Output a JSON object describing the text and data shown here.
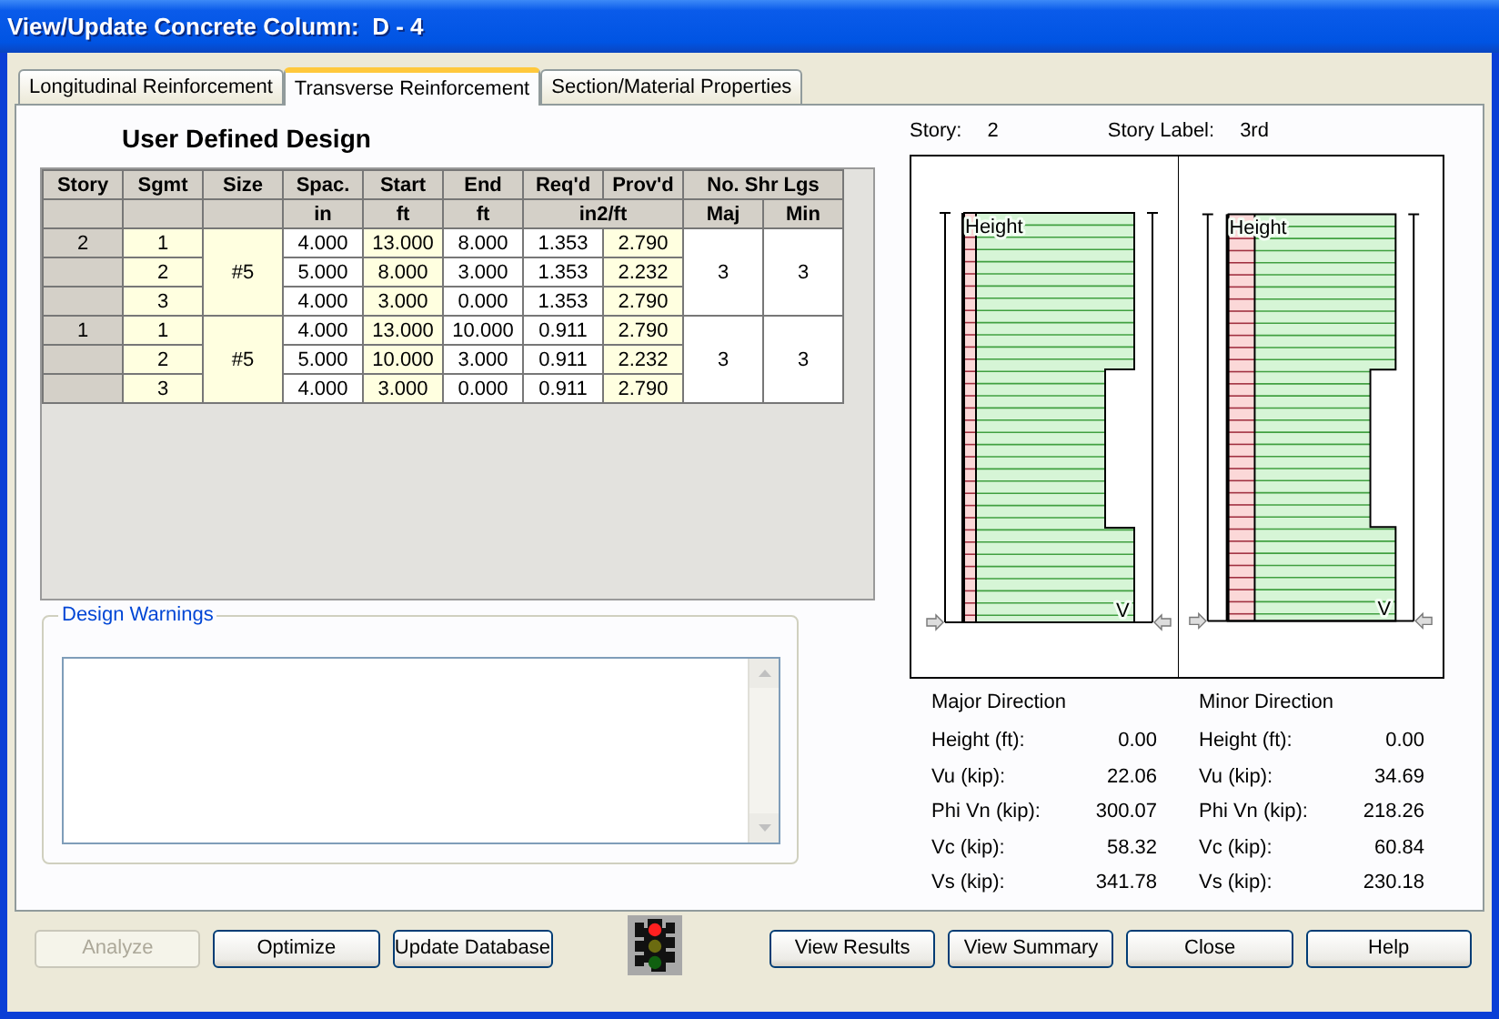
{
  "window": {
    "title": "View/Update Concrete Column:  D - 4"
  },
  "tabs": [
    {
      "label": "Longitudinal Reinforcement",
      "selected": false
    },
    {
      "label": "Transverse Reinforcement",
      "selected": true
    },
    {
      "label": "Section/Material Properties",
      "selected": false
    }
  ],
  "design": {
    "title": "User Defined Design",
    "columns": [
      "Story",
      "Sgmt",
      "Size",
      "Spac.",
      "Start",
      "End",
      "Req'd",
      "Prov'd"
    ],
    "column_group": {
      "label": "No. Shr Lgs",
      "columns": [
        "Maj",
        "Min"
      ]
    },
    "units": [
      "in",
      "ft",
      "ft",
      "in2/ft"
    ],
    "groups": [
      {
        "story": "2",
        "size": "#5",
        "maj": "3",
        "min": "3",
        "segments": [
          {
            "sgmt": "1",
            "spac": "4.000",
            "start": "13.000",
            "end": "8.000",
            "reqd": "1.353",
            "provd": "2.790"
          },
          {
            "sgmt": "2",
            "spac": "5.000",
            "start": "8.000",
            "end": "3.000",
            "reqd": "1.353",
            "provd": "2.232"
          },
          {
            "sgmt": "3",
            "spac": "4.000",
            "start": "3.000",
            "end": "0.000",
            "reqd": "1.353",
            "provd": "2.790"
          }
        ]
      },
      {
        "story": "1",
        "size": "#5",
        "maj": "3",
        "min": "3",
        "segments": [
          {
            "sgmt": "1",
            "spac": "4.000",
            "start": "13.000",
            "end": "10.000",
            "reqd": "0.911",
            "provd": "2.790"
          },
          {
            "sgmt": "2",
            "spac": "5.000",
            "start": "10.000",
            "end": "3.000",
            "reqd": "0.911",
            "provd": "2.232"
          },
          {
            "sgmt": "3",
            "spac": "4.000",
            "start": "3.000",
            "end": "0.000",
            "reqd": "0.911",
            "provd": "2.790"
          }
        ]
      }
    ]
  },
  "warnings": {
    "label": "Design Warnings"
  },
  "story": {
    "label": "Story:",
    "value": "2",
    "story_label": "Story Label:",
    "story_label_value": "3rd"
  },
  "diagrams": [
    {
      "axis_label": "Height",
      "shear_label": "V"
    },
    {
      "axis_label": "Height",
      "shear_label": "V"
    }
  ],
  "directions": [
    {
      "title": "Major Direction",
      "rows": [
        {
          "label": "Height (ft):",
          "value": "0.00"
        },
        {
          "label": "Vu (kip):",
          "value": "22.06"
        },
        {
          "label": "Phi Vn (kip):",
          "value": "300.07"
        },
        {
          "label": "Vc (kip):",
          "value": "58.32"
        },
        {
          "label": "Vs (kip):",
          "value": "341.78"
        }
      ]
    },
    {
      "title": "Minor Direction",
      "rows": [
        {
          "label": "Height (ft):",
          "value": "0.00"
        },
        {
          "label": "Vu (kip):",
          "value": "34.69"
        },
        {
          "label": "Phi Vn (kip):",
          "value": "218.26"
        },
        {
          "label": "Vc (kip):",
          "value": "60.84"
        },
        {
          "label": "Vs (kip):",
          "value": "230.18"
        }
      ]
    }
  ],
  "buttons": [
    {
      "label": "Analyze",
      "disabled": true
    },
    {
      "label": "Optimize",
      "disabled": false
    },
    {
      "label": "Update Database",
      "disabled": false
    },
    {
      "label": "View Results",
      "disabled": false
    },
    {
      "label": "View Summary",
      "disabled": false
    },
    {
      "label": "Close",
      "disabled": false
    },
    {
      "label": "Help",
      "disabled": false
    }
  ]
}
